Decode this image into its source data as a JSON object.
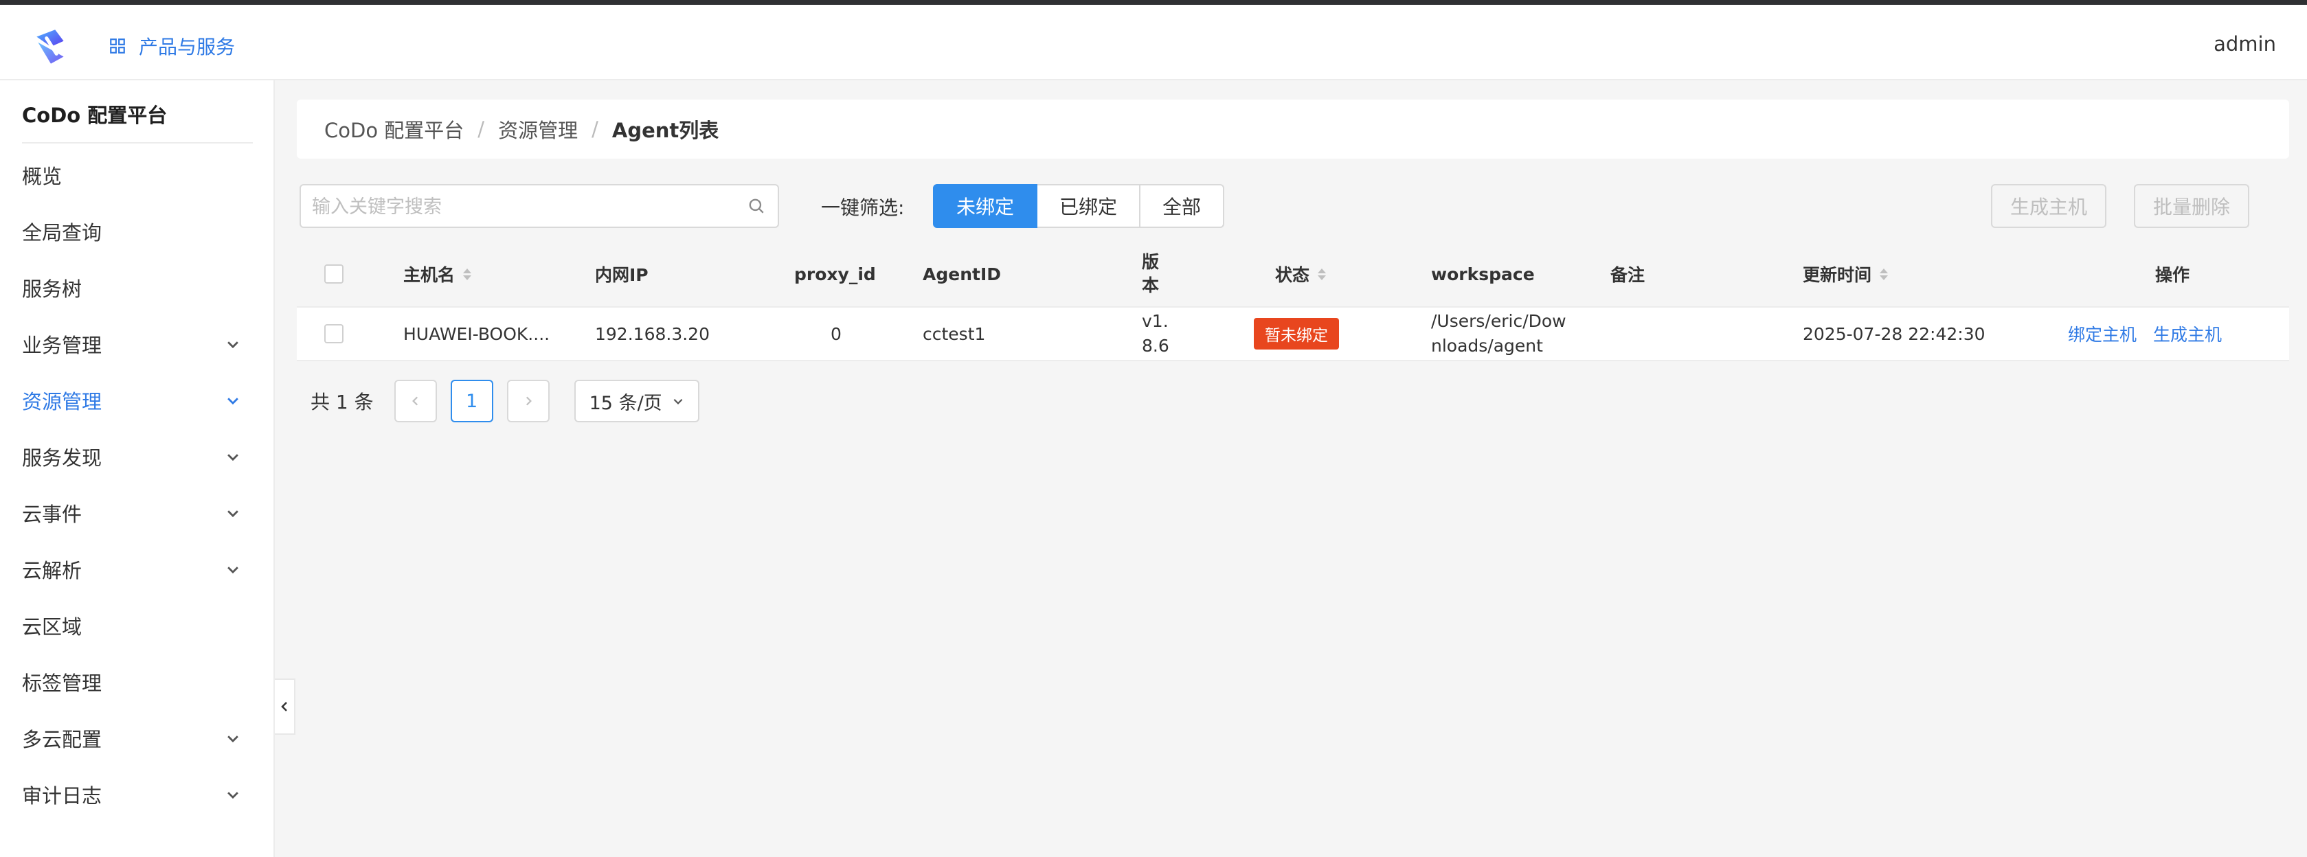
{
  "header": {
    "products_label": "产品与服务",
    "user": "admin"
  },
  "sidebar": {
    "brand": "CoDo 配置平台",
    "items": [
      {
        "label": "概览",
        "expandable": false,
        "active": false
      },
      {
        "label": "全局查询",
        "expandable": false,
        "active": false
      },
      {
        "label": "服务树",
        "expandable": false,
        "active": false
      },
      {
        "label": "业务管理",
        "expandable": true,
        "active": false
      },
      {
        "label": "资源管理",
        "expandable": true,
        "active": true
      },
      {
        "label": "服务发现",
        "expandable": true,
        "active": false
      },
      {
        "label": "云事件",
        "expandable": true,
        "active": false
      },
      {
        "label": "云解析",
        "expandable": true,
        "active": false
      },
      {
        "label": "云区域",
        "expandable": false,
        "active": false
      },
      {
        "label": "标签管理",
        "expandable": false,
        "active": false
      },
      {
        "label": "多云配置",
        "expandable": true,
        "active": false
      },
      {
        "label": "审计日志",
        "expandable": true,
        "active": false
      }
    ]
  },
  "breadcrumb": [
    "CoDo 配置平台",
    "资源管理",
    "Agent列表"
  ],
  "toolbar": {
    "search_placeholder": "输入关键字搜索",
    "filter_label": "一键筛选:",
    "filters": [
      "未绑定",
      "已绑定",
      "全部"
    ],
    "active_filter": "未绑定",
    "generate_host": "生成主机",
    "batch_delete": "批量删除"
  },
  "table": {
    "columns": {
      "hostname": "主机名",
      "ip": "内网IP",
      "proxy_id": "proxy_id",
      "agent_id": "AgentID",
      "version_l1": "版",
      "version_l2": "本",
      "status": "状态",
      "workspace": "workspace",
      "remark": "备注",
      "updated": "更新时间",
      "ops": "操作"
    },
    "rows": [
      {
        "hostname": "HUAWEI-BOOK....",
        "ip": "192.168.3.20",
        "proxy_id": "0",
        "agent_id": "cctest1",
        "version_l1": "v1.",
        "version_l2": "8.6",
        "status": "暂未绑定",
        "workspace_l1": "/Users/eric/Dow",
        "workspace_l2": "nloads/agent",
        "remark": "",
        "updated": "2025-07-28 22:42:30",
        "op_bind": "绑定主机",
        "op_generate": "生成主机"
      }
    ]
  },
  "pagination": {
    "total": "共 1 条",
    "current_page": "1",
    "page_size": "15 条/页"
  },
  "colors": {
    "primary": "#2f8ded",
    "link": "#2f7ae5",
    "danger_tag": "#e8461e"
  }
}
